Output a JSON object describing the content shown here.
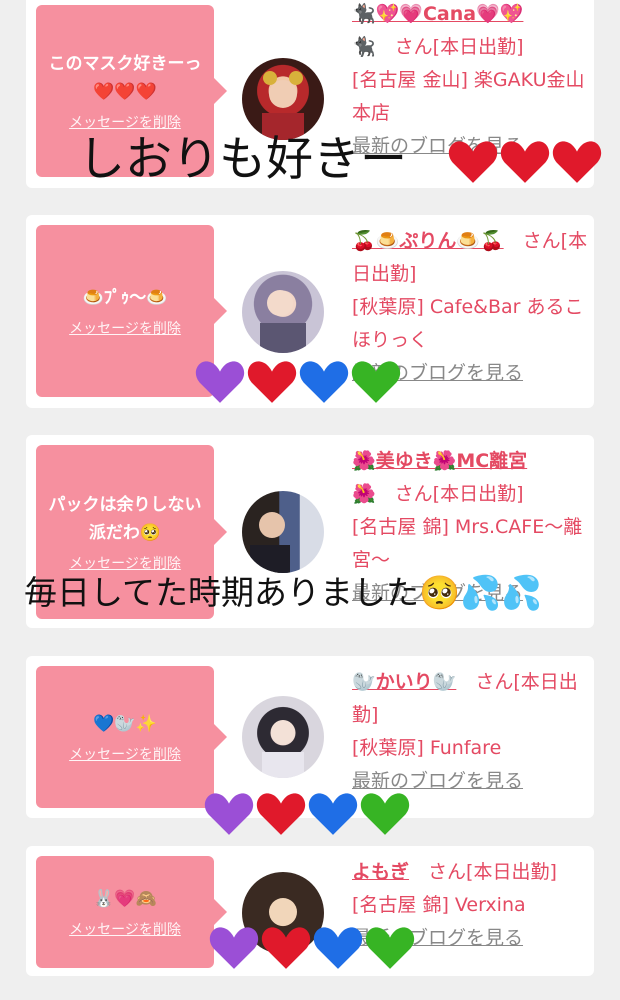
{
  "cards": [
    {
      "message": "このマスク好きーっ❤️❤️❤️",
      "delete_label": "メッセージを削除",
      "name": "🐈‍⬛💖💗Cana💗💖",
      "name_line2": "🐈‍⬛　さん[本日出勤]",
      "shop": "[名古屋 金山] 楽GAKU金山本店",
      "blog_label": "最新のブログを見る"
    },
    {
      "message": "🍮ﾌﾟｩ〜🍮",
      "delete_label": "メッセージを削除",
      "name": "🍒🍮ぷりん🍮🍒",
      "name_suffix": "さん[本日出勤]",
      "shop": "[秋葉原] Cafe&Bar あるこほりっく",
      "blog_label": "最新のブログを見る"
    },
    {
      "message": "パックは余りしない派だわ🥺",
      "delete_label": "メッセージを削除",
      "name": "🌺美ゆき🌺MC離宮",
      "name_line2": "🌺　さん[本日出勤]",
      "shop": "[名古屋 錦] Mrs.CAFE〜離宮〜",
      "blog_label": "最新のブログを見る"
    },
    {
      "message": "💙🦭✨",
      "delete_label": "メッセージを削除",
      "name": "🦭かいり🦭",
      "name_suffix": "さん[本日出勤]",
      "shop": "[秋葉原] Funfare",
      "blog_label": "最新のブログを見る"
    },
    {
      "message": "🐰💗🙈",
      "delete_label": "メッセージを削除",
      "name": "よもぎ",
      "name_suffix": "さん[本日出勤]",
      "shop": "[名古屋 錦] Verxina",
      "blog_label": "最新のブログを見る"
    }
  ],
  "overlays": {
    "caption1": "しおりも好きー",
    "caption2": "毎日してた時期ありました🥺💦💦"
  },
  "colors": {
    "bubble": "#f6909f",
    "accent_text": "#e44a63",
    "heart_purple": "#9b4fd6",
    "heart_red": "#e0192b",
    "heart_blue": "#1f6ee6",
    "heart_green": "#37b424"
  }
}
